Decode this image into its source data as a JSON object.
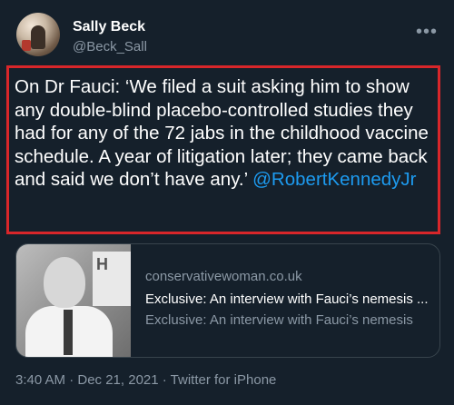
{
  "author": {
    "name": "Sally Beck",
    "handle": "@Beck_Sall"
  },
  "more_icon": "more-horizontal-icon",
  "tweet": {
    "text": "On Dr Fauci: ‘We filed a suit asking him to show any double-blind placebo-controlled studies they had for any of the 72 jabs in the childhood vaccine schedule. A year of litigation later; they came back and said we don’t have any.’ ",
    "mention": "@RobertKennedyJr",
    "highlight_border_color": "#d8262a",
    "mention_color": "#1d9bf0"
  },
  "card": {
    "domain": "conservativewoman.co.uk",
    "title": "Exclusive: An interview with Fauci’s nemesis ...",
    "description": "Exclusive: An interview with Fauci’s nemesis"
  },
  "meta": {
    "line": "3:40 AM · Dec 21, 2021 · Twitter for iPhone"
  }
}
